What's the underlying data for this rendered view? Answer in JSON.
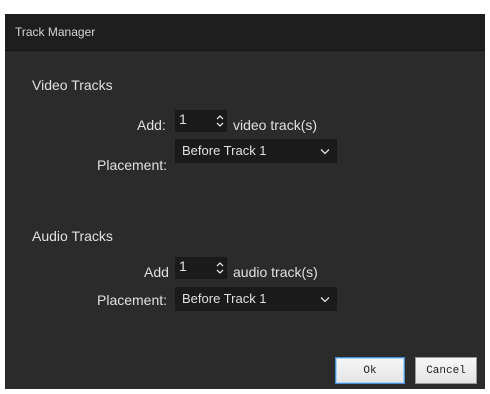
{
  "window": {
    "title": "Track Manager"
  },
  "video": {
    "heading": "Video Tracks",
    "add_label": "Add:",
    "add_value": "1",
    "add_suffix": "video track(s)",
    "placement_label": "Placement:",
    "placement_value": "Before Track 1"
  },
  "audio": {
    "heading": "Audio Tracks",
    "add_label": "Add",
    "add_value": "1",
    "add_suffix": "audio track(s)",
    "placement_label": "Placement:",
    "placement_value": "Before Track 1"
  },
  "buttons": {
    "ok": "Ok",
    "cancel": "Cancel"
  },
  "icons": {
    "spin": "spin-arrows-icon",
    "combo": "chevron-down-icon"
  },
  "colors": {
    "dialog_bg": "#2b2b2b",
    "titlebar_bg": "#1e1e1e",
    "text": "#e0e0e0",
    "field_bg": "#1a1a1a",
    "ok_border": "#4a90d9"
  }
}
